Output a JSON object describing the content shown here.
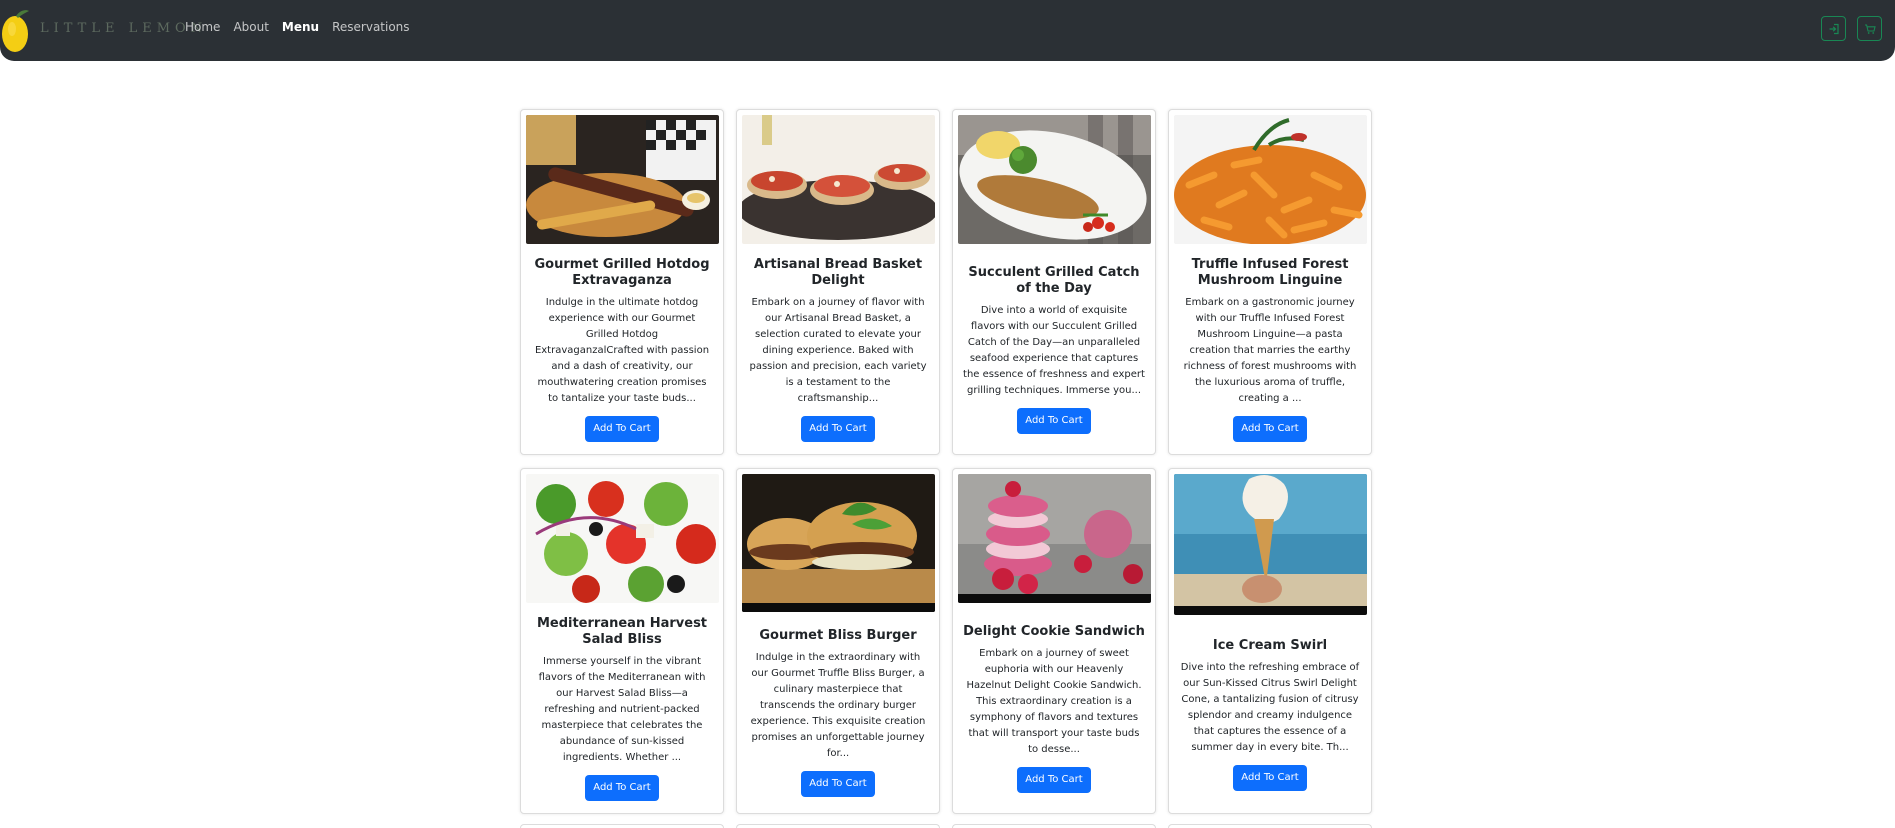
{
  "brand": {
    "name": "LITTLE LEMON"
  },
  "nav": {
    "links": [
      {
        "label": "Home"
      },
      {
        "label": "About"
      },
      {
        "label": "Menu",
        "active": true
      },
      {
        "label": "Reservations"
      }
    ],
    "login_icon": "login-icon",
    "cart_icon": "cart-icon"
  },
  "theme": {
    "navbar_bg": "#2b3035",
    "primary": "#0d6efd",
    "success_outline": "#198754",
    "brand_text": "#5d6a5f"
  },
  "menu": {
    "items": [
      {
        "title": "Gourmet Grilled Hotdog Extravaganza",
        "description": "Indulge in the ultimate hotdog experience with our Gourmet Grilled Hotdog ExtravaganzalCrafted with passion and a dash of creativity, our mouthwatering creation promises to tantalize your taste buds...",
        "button": "Add To Cart"
      },
      {
        "title": "Artisanal Bread Basket Delight",
        "description": "Embark on a journey of flavor with our Artisanal Bread Basket, a selection curated to elevate your dining experience. Baked with passion and precision, each variety is a testament to the craftsmanship...",
        "button": "Add To Cart"
      },
      {
        "title": "Succulent Grilled Catch of the Day",
        "description": "Dive into a world of exquisite flavors with our Succulent Grilled Catch of the Day—an unparalleled seafood experience that captures the essence of freshness and expert grilling techniques. Immerse you...",
        "button": "Add To Cart"
      },
      {
        "title": "Truffle Infused Forest Mushroom Linguine",
        "description": "Embark on a gastronomic journey with our Truffle Infused Forest Mushroom Linguine—a pasta creation that marries the earthy richness of forest mushrooms with the luxurious aroma of truffle, creating a ...",
        "button": "Add To Cart"
      },
      {
        "title": "Mediterranean Harvest Salad Bliss",
        "description": "Immerse yourself in the vibrant flavors of the Mediterranean with our Harvest Salad Bliss—a refreshing and nutrient-packed masterpiece that celebrates the abundance of sun-kissed ingredients. Whether ...",
        "button": "Add To Cart"
      },
      {
        "title": "Gourmet Bliss Burger",
        "description": "Indulge in the extraordinary with our Gourmet Truffle Bliss Burger, a culinary masterpiece that transcends the ordinary burger experience. This exquisite creation promises an unforgettable journey for...",
        "button": "Add To Cart"
      },
      {
        "title": "Delight Cookie Sandwich",
        "description": "Embark on a journey of sweet euphoria with our Heavenly Hazelnut Delight Cookie Sandwich. This extraordinary creation is a symphony of flavors and textures that will transport your taste buds to desse...",
        "button": "Add To Cart"
      },
      {
        "title": "Ice Cream Swirl",
        "description": "Dive into the refreshing embrace of our Sun-Kissed Citrus Swirl Delight Cone, a tantalizing fusion of citrusy splendor and creamy indulgence that captures the essence of a summer day in every bite. Th...",
        "button": "Add To Cart"
      }
    ]
  }
}
